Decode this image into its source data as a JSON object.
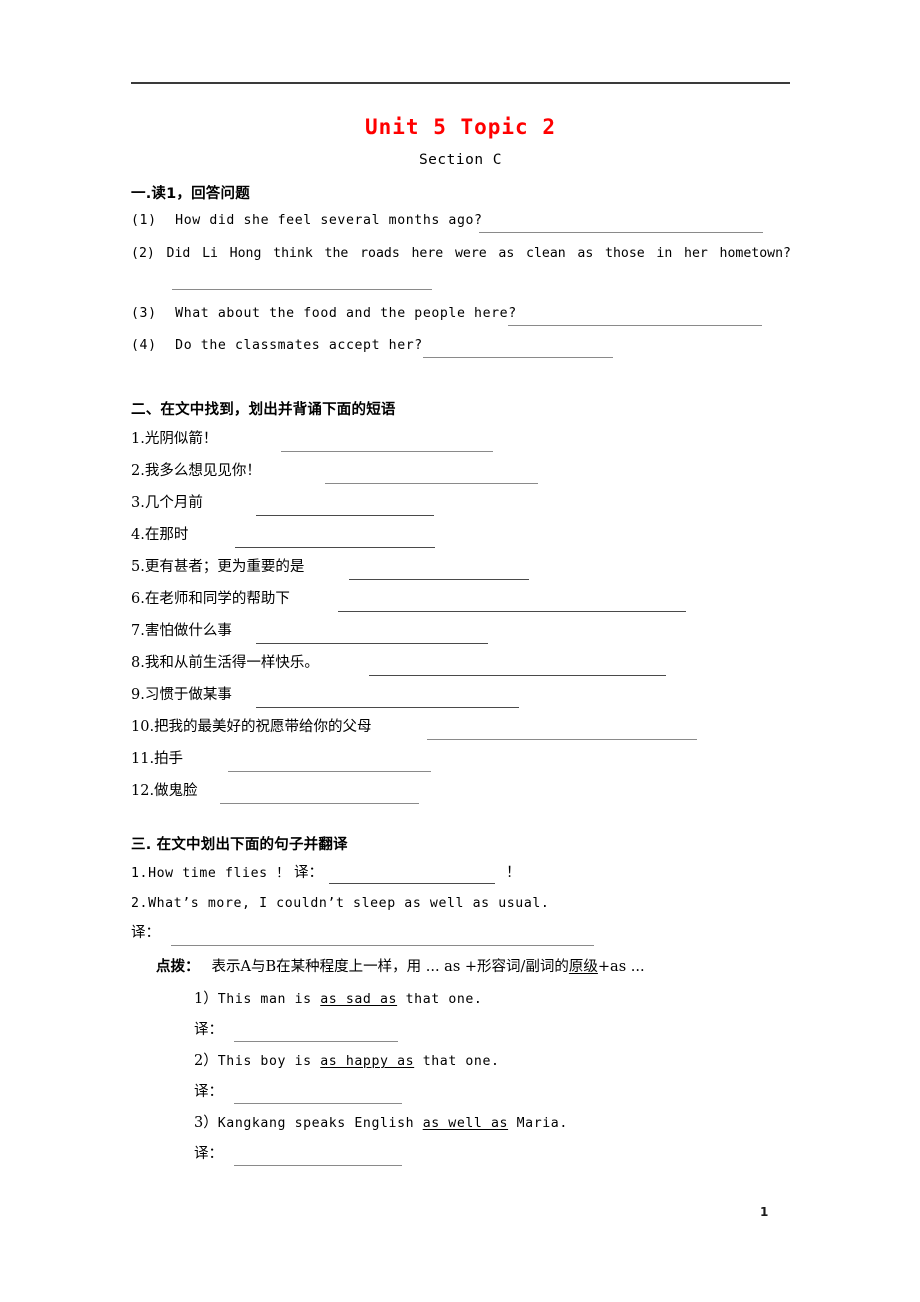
{
  "document": {
    "title": "Unit 5  Topic 2",
    "subtitle": "Section C",
    "page_number": "1"
  },
  "section_one": {
    "heading": "一.读1，回答问题",
    "questions": [
      {
        "num": "(1)",
        "text": "How did she feel several months ago?"
      },
      {
        "num": "(2)",
        "text": "Did Li Hong think the roads here were as clean as those in her hometown?"
      },
      {
        "num": "(3)",
        "text": "What about the food and the people here?"
      },
      {
        "num": "(4)",
        "text": "Do the classmates accept her?"
      }
    ],
    "q2_words": [
      "Did",
      "Li",
      "Hong",
      "think",
      "the",
      "roads",
      "here",
      "were",
      "as",
      "clean",
      "as",
      "those",
      "in",
      "her",
      "hometown?"
    ]
  },
  "section_two": {
    "heading": "二、在文中找到，划出并背诵下面的短语",
    "items": [
      {
        "num": "1.",
        "text": "光阴似箭！"
      },
      {
        "num": "2.",
        "text": "我多么想见见你！"
      },
      {
        "num": "3.",
        "text": "几个月前"
      },
      {
        "num": "4.",
        "text": "在那时"
      },
      {
        "num": "5.",
        "text": "更有甚者；更为重要的是"
      },
      {
        "num": "6.",
        "text": "在老师和同学的帮助下"
      },
      {
        "num": "7.",
        "text": "害怕做什么事"
      },
      {
        "num": "8.",
        "text": "我和从前生活得一样快乐。"
      },
      {
        "num": "9.",
        "text": "习惯于做某事"
      },
      {
        "num": "10.",
        "text": "把我的最美好的祝愿带给你的父母"
      },
      {
        "num": "11.",
        "text": "拍手"
      },
      {
        "num": "12.",
        "text": "做鬼脸"
      }
    ]
  },
  "section_three": {
    "heading": "三.  在文中划出下面的句子并翻译",
    "sentence_1": {
      "num": "1.",
      "text": "How time flies ！",
      "translate_label": "译：",
      "trailing": "！"
    },
    "sentence_2": {
      "num": "2.",
      "text": "What’s more, I couldn’t sleep as well as usual.",
      "translate_label": "译："
    },
    "tip": {
      "label": "点拨：",
      "text_before": "表示A与B在某种程度上一样，用 ... as +形容词/副词的",
      "underlined": "原级",
      "text_after": "+as ..."
    },
    "examples": [
      {
        "num": "1）",
        "before": "This man is ",
        "phrase": "as sad as",
        "after": " that one.",
        "translate_label": "译："
      },
      {
        "num": "2）",
        "before": "This boy is ",
        "phrase": "as happy as",
        "after": " that one.",
        "translate_label": "译："
      },
      {
        "num": "3）",
        "before": "Kangkang speaks English ",
        "phrase": "as well as",
        "after": " Maria.",
        "translate_label": "译："
      }
    ]
  }
}
